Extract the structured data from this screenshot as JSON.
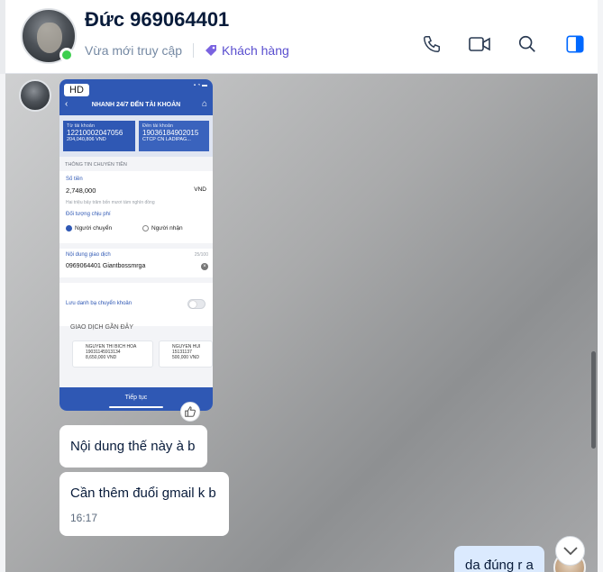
{
  "header": {
    "contact_name": "Đức 969064401",
    "status": "Vừa mới truy cập",
    "tag": "Khách hàng",
    "tag_color": "#5a4fcf",
    "icons": [
      "phone-icon",
      "video-call-icon",
      "search-icon",
      "sidebar-toggle-icon"
    ]
  },
  "image_message": {
    "hd_badge": "HD",
    "screen_title": "NHANH 24/7 ĐẾN TÀI KHOẢN",
    "status_bar": "▪ ◔ ▬",
    "from_label": "Từ tài khoản",
    "from_account": "12210002047056",
    "from_balance": "204,040,806 VND",
    "to_label": "Đến tài khoản",
    "to_account": "19036184902015",
    "to_name": "CTCP CN LADIPAG...",
    "section_info": "THÔNG TIN CHUYỂN TIỀN",
    "amount_label": "Số tiền",
    "amount": "2,748,000",
    "currency": "VND",
    "amount_words": "Hai triệu bảy trăm bốn mươi tám nghìn đồng",
    "fee_label": "Đối tượng chịu phí",
    "fee_sender": "Người chuyển",
    "fee_receiver": "Người nhận",
    "content_label": "Nội dung giao dịch",
    "content_counter": "25/100",
    "content": "0969064401 Giantbossmrga",
    "save_beneficiary": "Lưu danh bạ chuyển khoản",
    "recent_title": "GIAO DỊCH GẦN ĐÂY",
    "recent": [
      {
        "name": "NGUYEN THI BICH HOA",
        "account": "19031145913134",
        "amount": "8,650,000 VND"
      },
      {
        "name": "NGUYEN HUI",
        "account": "15131137",
        "amount": "500,000 VND"
      }
    ],
    "continue_button": "Tiếp tục"
  },
  "messages": {
    "m1": "Nội dung thế này à b",
    "m2": "Cần thêm đuổi gmail k b",
    "m2_time": "16:17",
    "m3": "da đúng r a"
  }
}
